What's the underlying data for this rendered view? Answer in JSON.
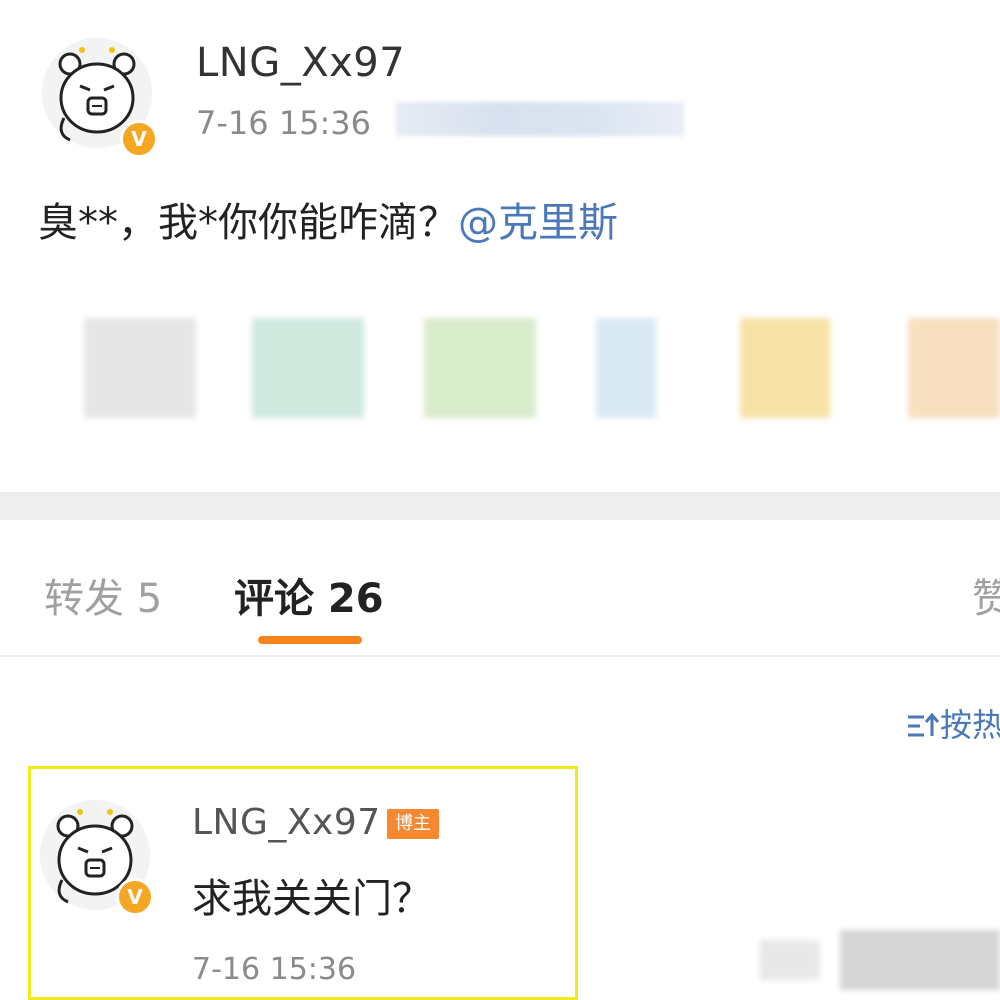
{
  "post": {
    "username": "LNG_Xx97",
    "timestamp": "7-16 15:36",
    "text": "臭**，我*你你能咋滴？",
    "mention": "@克里斯",
    "verified_badge": "V",
    "thumbnail_colors": [
      "#e6e6e6",
      "#cfe9df",
      "#d9eccb",
      "#d9e9f4",
      "#f7e2a6",
      "#f7dfbf"
    ]
  },
  "tabs": {
    "repost": "转发 5",
    "comments": "评论 26",
    "likes": "赞"
  },
  "sort": {
    "icon": "sort-icon",
    "label": "按热"
  },
  "comment": {
    "username": "LNG_Xx97",
    "owner_tag": "博主",
    "text": "求我关关门？",
    "timestamp": "7-16 15:36",
    "verified_badge": "V"
  },
  "colors": {
    "accent": "#f5841f",
    "link": "#4a78b8",
    "badge": "#f5a623",
    "highlight": "#f2ea1c"
  }
}
